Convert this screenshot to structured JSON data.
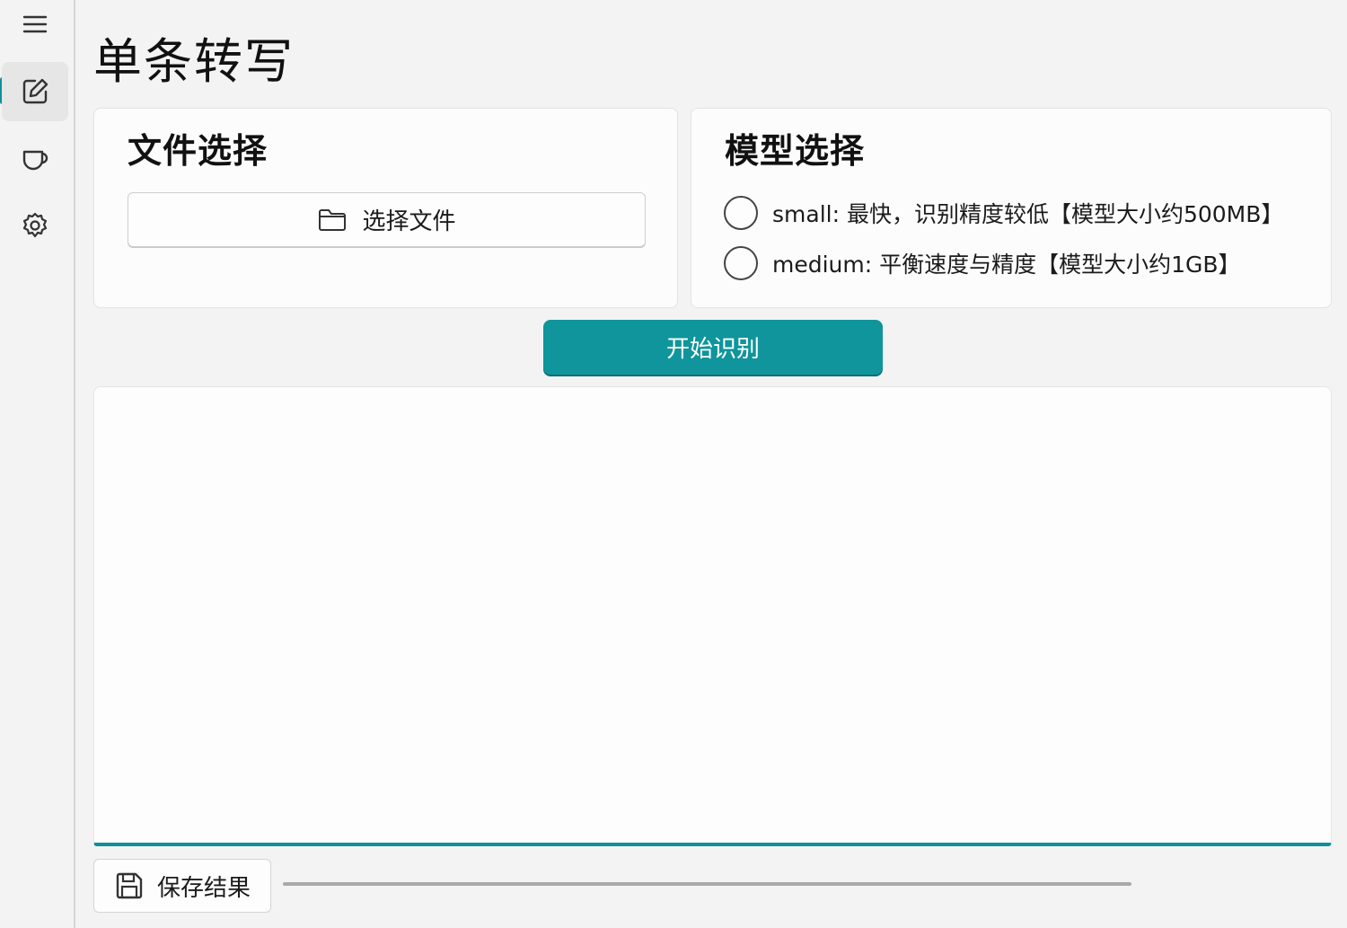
{
  "sidebar": {
    "items": [
      {
        "icon": "hamburger-menu-icon",
        "active": false
      },
      {
        "icon": "edit-icon",
        "active": true
      },
      {
        "icon": "coffee-cup-icon",
        "active": false
      },
      {
        "icon": "gear-icon",
        "active": false
      }
    ]
  },
  "page": {
    "title": "单条转写"
  },
  "file_card": {
    "title": "文件选择",
    "select_button_label": "选择文件",
    "select_button_icon": "folder-icon"
  },
  "model_card": {
    "title": "模型选择",
    "options": [
      {
        "label": "small: 最快，识别精度较低【模型大小约500MB】",
        "selected": false
      },
      {
        "label": "medium: 平衡速度与精度【模型大小约1GB】",
        "selected": false
      }
    ]
  },
  "actions": {
    "start_button_label": "开始识别",
    "save_button_label": "保存结果",
    "save_button_icon": "save-disk-icon"
  },
  "result": {
    "text": ""
  },
  "progress": {
    "value": 0
  },
  "colors": {
    "accent": "#0f959b",
    "background": "#f3f3f3",
    "card": "#fcfcfc"
  }
}
